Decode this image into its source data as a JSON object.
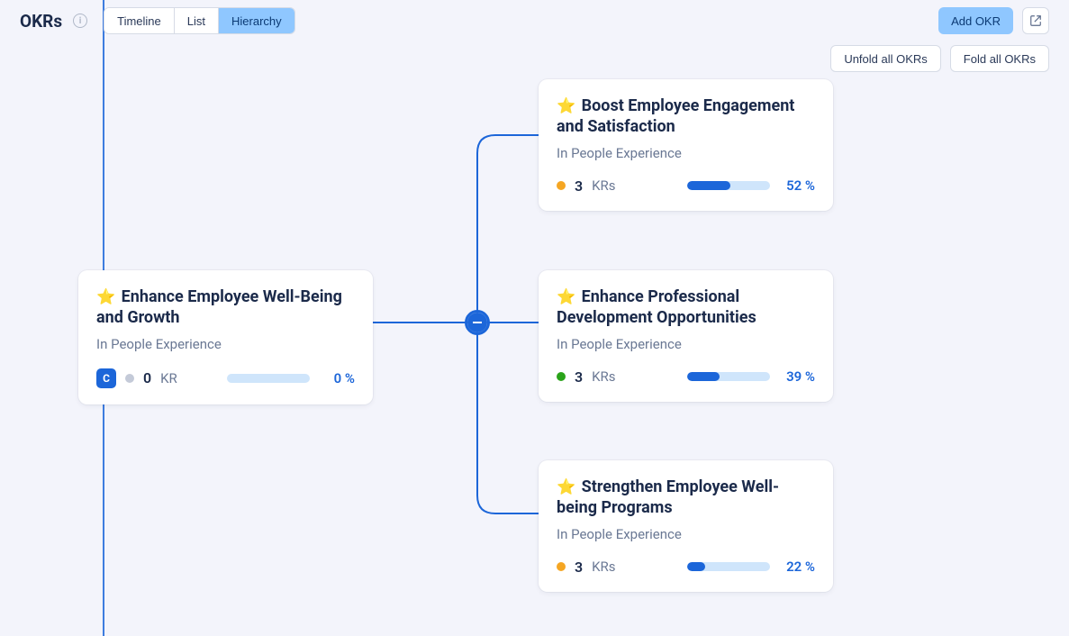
{
  "header": {
    "title": "OKRs",
    "tabs": {
      "timeline": "Timeline",
      "list": "List",
      "hierarchy": "Hierarchy"
    },
    "add_okr": "Add OKR"
  },
  "subactions": {
    "unfold": "Unfold all OKRs",
    "fold": "Fold all OKRs"
  },
  "parent": {
    "icon": "⭐",
    "title": "Enhance Employee Well-Being and Growth",
    "dept": "In People Experience",
    "avatar_letter": "C",
    "kr_count": "0",
    "kr_label": "KR",
    "percent": "0 %",
    "progress_pct": 0,
    "status": "gray"
  },
  "children": [
    {
      "icon": "⭐",
      "title": "Boost Employee Engagement and Satisfaction",
      "dept": "In People Experience",
      "kr_count": "3",
      "kr_label": "KRs",
      "percent": "52 %",
      "progress_pct": 52,
      "status": "orange"
    },
    {
      "icon": "⭐",
      "title": "Enhance Professional Development Opportunities",
      "dept": "In People Experience",
      "kr_count": "3",
      "kr_label": "KRs",
      "percent": "39 %",
      "progress_pct": 39,
      "status": "green"
    },
    {
      "icon": "⭐",
      "title": "Strengthen Employee Well-being Programs",
      "dept": "In People Experience",
      "kr_count": "3",
      "kr_label": "KRs",
      "percent": "22 %",
      "progress_pct": 22,
      "status": "orange"
    }
  ]
}
